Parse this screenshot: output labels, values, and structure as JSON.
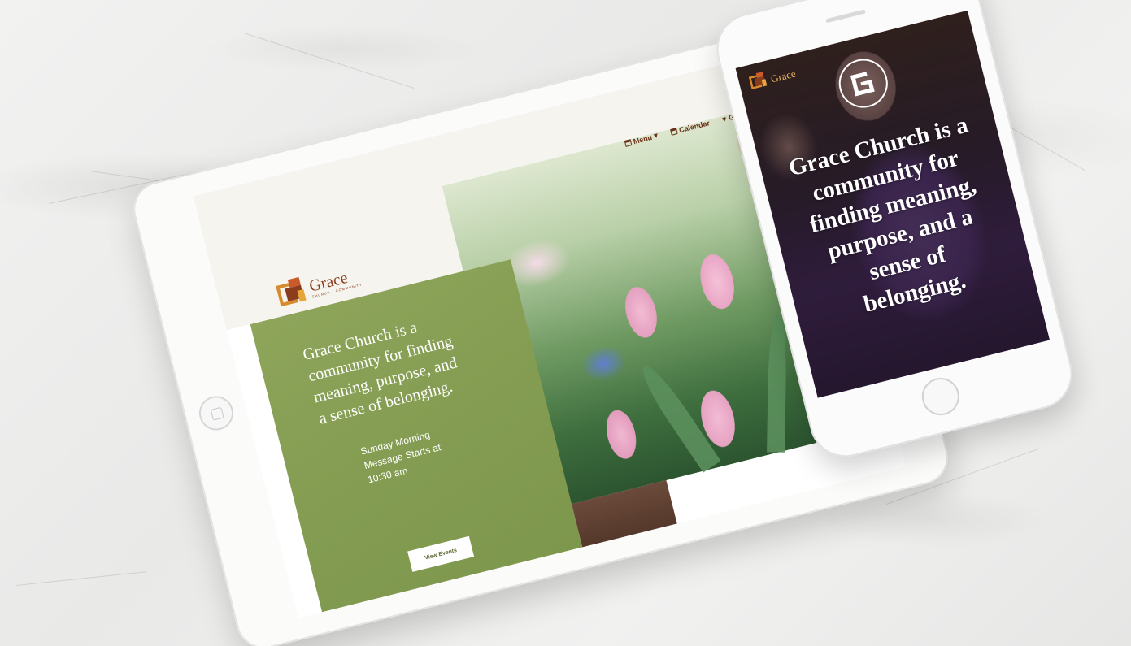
{
  "tablet": {
    "logo": {
      "wordmark": "Grace",
      "tagline": "CHURCH · COMMUNITY"
    },
    "nav": {
      "menu": "Menu",
      "calendar": "Calendar",
      "give": "Give"
    },
    "hero": {
      "headline": "Grace Church is a community for finding meaning, purpose, and a sense of belonging.",
      "subtext": "Sunday Morning Message Starts at 10:30 am",
      "button": "View Events"
    }
  },
  "phone": {
    "logo": {
      "wordmark": "Grace"
    },
    "hero": {
      "headline": "Grace Church is a community for finding meaning, purpose, and a sense of belonging."
    }
  },
  "icons": [
    "book-icon",
    "calendar-icon",
    "heart-icon",
    "search-icon",
    "chevron-down-icon"
  ],
  "colors": {
    "brand_brown": "#6a3118",
    "brand_orange": "#d88a2e",
    "hero_green": "#849d52",
    "phone_overlay": "#2d2232"
  }
}
